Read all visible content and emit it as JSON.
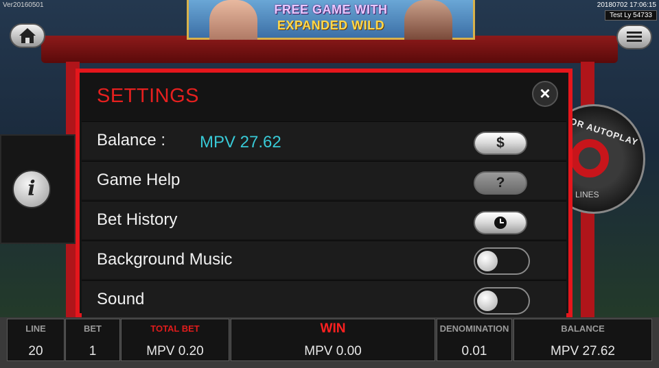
{
  "version": "Ver20160501",
  "datetime": "20180702 17:06:15",
  "tester": "Test Ly 54733",
  "banner": {
    "line1": "FREE GAME WITH",
    "line2": "EXPANDED WILD"
  },
  "side": {
    "info_glyph": "i",
    "autoplay": "OR AUTOPLAY",
    "lines": "LINES"
  },
  "settings": {
    "title": "SETTINGS",
    "close_glyph": "×",
    "balance_label": "Balance :",
    "balance_value": "MPV 27.62",
    "balance_btn": "$",
    "help_label": "Game Help",
    "help_btn": "?",
    "history_label": "Bet History",
    "music_label": "Background Music",
    "sound_label": "Sound"
  },
  "bottom": {
    "line": {
      "label": "LINE",
      "value": "20"
    },
    "bet": {
      "label": "BET",
      "value": "1"
    },
    "total_bet": {
      "label": "TOTAL BET",
      "value": "MPV 0.20"
    },
    "win": {
      "label": "WIN",
      "value": "MPV 0.00"
    },
    "denomination": {
      "label": "DENOMINATION",
      "value": "0.01"
    },
    "balance": {
      "label": "BALANCE",
      "value": "MPV 27.62"
    }
  },
  "colors": {
    "accent_red": "#e5161c",
    "balance_cyan": "#38c9d6"
  }
}
